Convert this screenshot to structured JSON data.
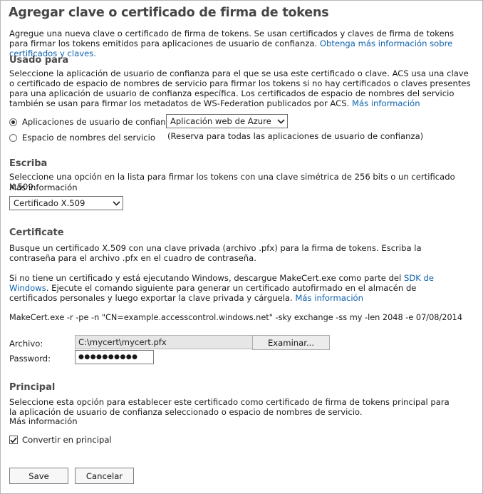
{
  "title": "Agregar clave o certificado de firma de tokens",
  "intro": {
    "text": "Agregue una nueva clave o certificado de firma de tokens. Se usan certificados y claves de firma de tokens para firmar los tokens emitidos para aplicaciones de usuario de confianza. ",
    "link": "Obtenga más información sobre certificados y claves."
  },
  "used_for": {
    "heading": "Usado para",
    "desc": "Seleccione la aplicación de usuario de confianza para el que se usa este certificado o clave. ACS usa una clave o certificado de espacio de nombres de servicio para firmar los tokens si no hay certificados o claves presentes para una aplicación de usuario de confianza específica. Los certificados de espacio de nombres del servicio también se usan para firmar los metadatos de WS-Federation publicados por ACS. ",
    "link": "Más información",
    "option_rp": "Aplicaciones de usuario de confianza",
    "option_ns": "Espacio de nombres del servicio",
    "rp_select_value": "Aplicación web de Azure",
    "ns_note": "(Reserva para todas las aplicaciones de usuario de confianza)"
  },
  "type": {
    "heading": "Escriba",
    "desc": "Seleccione una opción en la lista para firmar los tokens con una clave simétrica de 256 bits o un certificado X.509.",
    "link": "Más información",
    "select_value": "Certificado X.509"
  },
  "certificate": {
    "heading": "Certificate",
    "desc1": "Busque un certificado X.509 con una clave privada (archivo .pfx) para la firma de tokens. Escriba la contraseña para el archivo .pfx en el cuadro de contraseña.",
    "desc2_a": "Si no tiene un certificado y está ejecutando Windows, descargue MakeCert.exe como parte del ",
    "desc2_link": "SDK de Windows",
    "desc2_b": ". Ejecute el comando siguiente para generar un certificado autofirmado en el almacén de certificados personales y luego exportar la clave privada y cárguela. ",
    "desc2_link2": "Más información",
    "command": "MakeCert.exe -r -pe -n \"CN=example.accesscontrol.windows.net\" -sky exchange -ss my -len 2048 -e 07/08/2014",
    "file_label": "Archivo:",
    "file_value": "C:\\mycert\\mycert.pfx",
    "browse_label": "Examinar...",
    "password_label": "Password:",
    "password_value": "●●●●●●●●●●"
  },
  "principal": {
    "heading": "Principal",
    "desc": "Seleccione esta opción para establecer este certificado como certificado de firma de tokens principal para la aplicación de usuario de confianza seleccionado o espacio de nombres de servicio.",
    "link": "Más información",
    "checkbox_label": "Convertir en principal"
  },
  "actions": {
    "save": "Save",
    "cancel": "Cancelar"
  }
}
